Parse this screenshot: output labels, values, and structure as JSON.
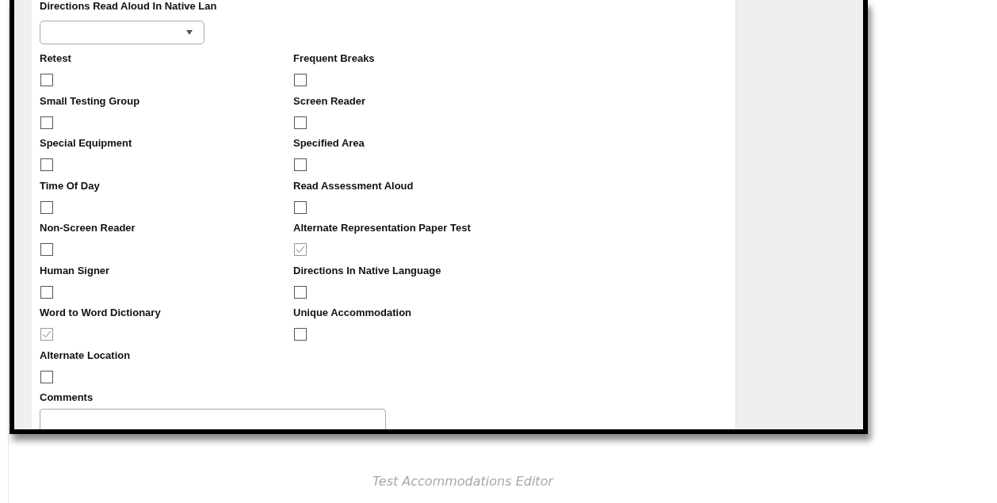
{
  "editor": {
    "top_field": {
      "label": "Directions Read Aloud In Native Lan"
    },
    "fields": [
      {
        "label": "Retest",
        "checked": false
      },
      {
        "label": "Frequent Breaks",
        "checked": false
      },
      {
        "label": "Small Testing Group",
        "checked": false
      },
      {
        "label": "Screen Reader",
        "checked": false
      },
      {
        "label": "Special Equipment",
        "checked": false
      },
      {
        "label": "Specified Area",
        "checked": false
      },
      {
        "label": "Time Of Day",
        "checked": false
      },
      {
        "label": "Read Assessment Aloud",
        "checked": false
      },
      {
        "label": "Non-Screen Reader",
        "checked": false
      },
      {
        "label": "Alternate Representation Paper Test",
        "checked": true
      },
      {
        "label": "Human Signer",
        "checked": false
      },
      {
        "label": "Directions In Native Language",
        "checked": false
      },
      {
        "label": "Word to Word Dictionary",
        "checked": true
      },
      {
        "label": "Unique Accommodation",
        "checked": false
      },
      {
        "label": "Alternate Location",
        "checked": false
      }
    ],
    "comments": {
      "label": "Comments"
    }
  },
  "caption": "Test Accommodations Editor"
}
